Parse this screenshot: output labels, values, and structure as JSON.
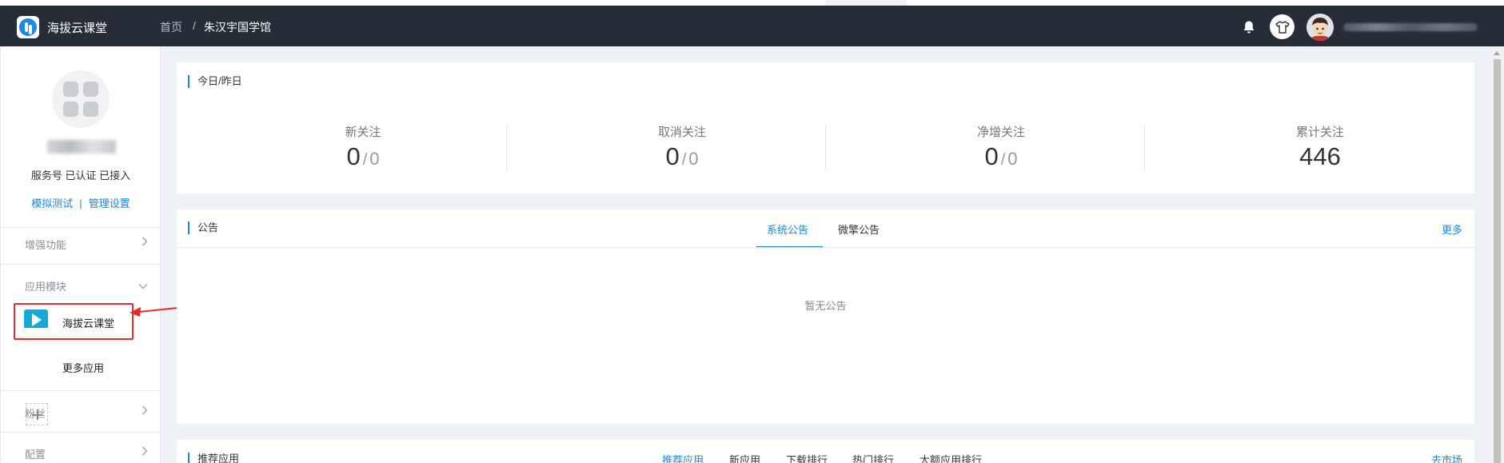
{
  "header": {
    "app_name": "海拔云课堂",
    "breadcrumb": {
      "home": "首页",
      "separator": "/",
      "current": "朱汉宇国学馆"
    },
    "icons": [
      "bell-icon",
      "shirt-icon",
      "user-avatar"
    ]
  },
  "sidebar": {
    "account_status": "服务号 已认证 已接入",
    "links": {
      "simulate_test": "模拟测试",
      "separator": "|",
      "manage_settings": "管理设置"
    },
    "sections": {
      "enhanced": "增强功能",
      "app_modules": "应用模块",
      "fans": "粉丝",
      "config": "配置"
    },
    "apps": [
      {
        "label": "海拔云课堂",
        "icon": "video-app-icon",
        "selected": true
      },
      {
        "label": "更多应用",
        "icon": "plus-icon",
        "selected": false
      }
    ]
  },
  "today_card": {
    "title": "今日/昨日",
    "stats": [
      {
        "label": "新关注",
        "today": "0",
        "separator": "/",
        "yesterday": "0"
      },
      {
        "label": "取消关注",
        "today": "0",
        "separator": "/",
        "yesterday": "0"
      },
      {
        "label": "净增关注",
        "today": "0",
        "separator": "/",
        "yesterday": "0"
      },
      {
        "label": "累计关注",
        "total": "446"
      }
    ]
  },
  "notice_card": {
    "title": "公告",
    "tabs": [
      {
        "label": "系统公告",
        "active": true
      },
      {
        "label": "微擎公告",
        "active": false
      }
    ],
    "more": "更多",
    "empty": "暂无公告"
  },
  "apps_card": {
    "title": "推荐应用",
    "tabs": [
      {
        "label": "推荐应用",
        "active": true
      },
      {
        "label": "新应用",
        "active": false
      },
      {
        "label": "下载排行",
        "active": false
      },
      {
        "label": "热门排行",
        "active": false
      },
      {
        "label": "大额应用排行",
        "active": false
      }
    ],
    "more": "去市场"
  },
  "colors": {
    "header_bg": "#272d37",
    "accent": "#1a85e8",
    "annotation_red": "#e8292e",
    "page_bg": "#eef1f5"
  }
}
